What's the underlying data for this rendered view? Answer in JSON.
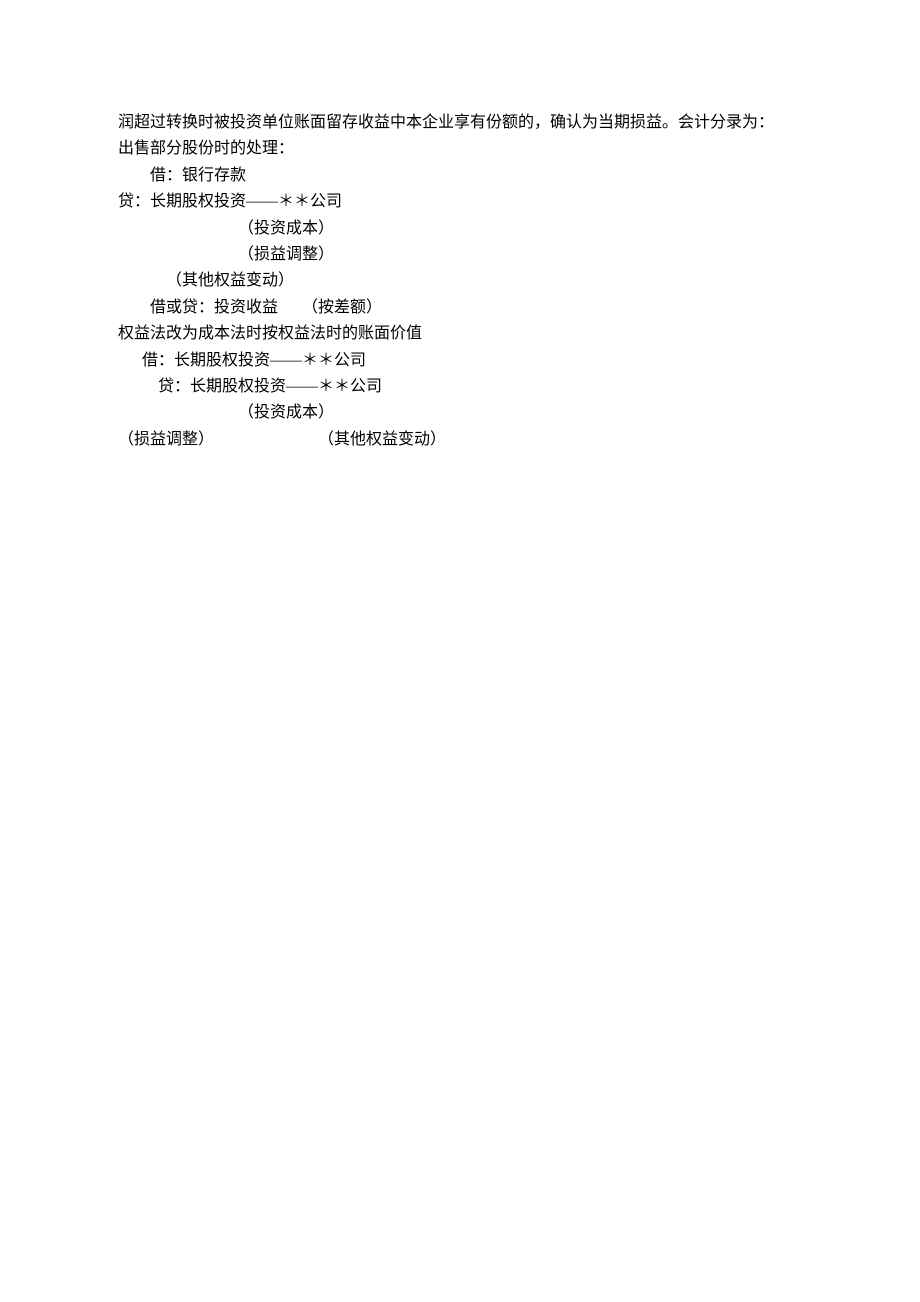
{
  "lines": {
    "l1": "润超过转换时被投资单位账面留存收益中本企业享有份额的，确认为当期损益。会计分录为：",
    "l2": "出售部分股份时的处理：",
    "l3": "        借：银行存款",
    "l4": "贷：长期股权投资——＊＊公司",
    "l5": "                              （投资成本）",
    "l6": "                              （损益调整）",
    "l7": "            （其他权益变动）",
    "l8": "        借或贷：投资收益      （按差额）",
    "l9": "权益法改为成本法时按权益法时的账面价值",
    "l10": "      借：长期股权投资——＊＊公司",
    "l11": "          贷：长期股权投资——＊＊公司",
    "l12": "                              （投资成本）",
    "l13": "（损益调整）                          （其他权益变动）"
  }
}
